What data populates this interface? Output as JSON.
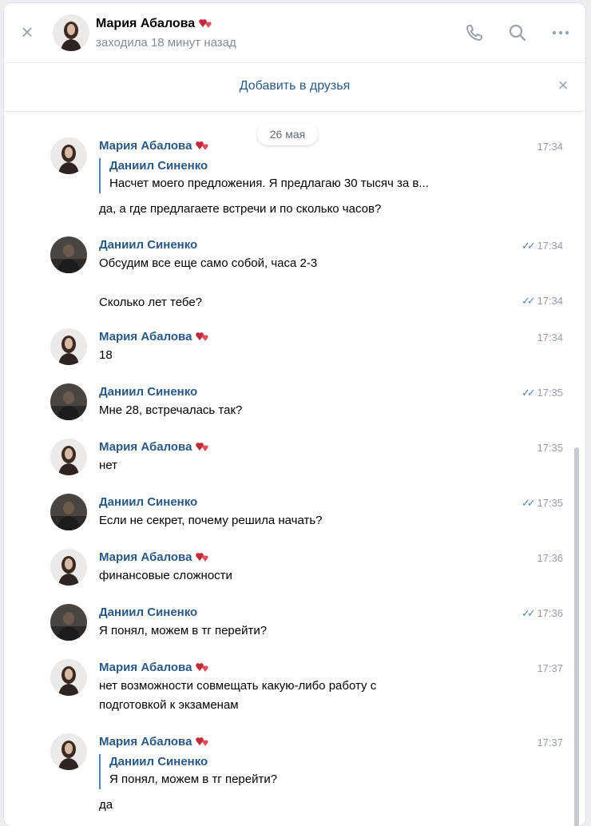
{
  "header": {
    "name": "Мария Абалова",
    "status": "заходила 18 минут назад",
    "icons": [
      "close-icon",
      "phone-icon",
      "search-icon",
      "more-icon"
    ]
  },
  "friend_bar": {
    "label": "Добавить в друзья"
  },
  "colors": {
    "link": "#2a5885",
    "accent": "#5181b8",
    "muted": "#818c99",
    "heart": "#c02a3a"
  },
  "chat": {
    "date": "26 мая",
    "messages": [
      {
        "author": "Мария Абалова",
        "time": "17:34",
        "quote_author": "Даниил Синенко",
        "quote_text": "Насчет моего предложения. Я предлагаю 30 тысяч за в...",
        "text": "да, а где предлагаете встречи и по сколько часов?"
      },
      {
        "author": "Даниил Синенко",
        "time": "17:34",
        "text": "Обсудим все еще само собой, часа 2-3"
      },
      {
        "time": "17:34",
        "text": "Сколько лет тебе?"
      },
      {
        "author": "Мария Абалова",
        "time": "17:34",
        "text": "18"
      },
      {
        "author": "Даниил Синенко",
        "time": "17:35",
        "text": "Мне 28, встречалась так?"
      },
      {
        "author": "Мария Абалова",
        "time": "17:35",
        "text": "нет"
      },
      {
        "author": "Даниил Синенко",
        "time": "17:35",
        "text": "Если не секрет, почему решила начать?"
      },
      {
        "author": "Мария Абалова",
        "time": "17:36",
        "text": "финансовые сложности"
      },
      {
        "author": "Даниил Синенко",
        "time": "17:36",
        "text": "Я понял, можем в тг перейти?"
      },
      {
        "author": "Мария Абалова",
        "time": "17:37",
        "text": "нет возможности совмещать какую-либо работу с",
        "text2": "подготовкой к экзаменам"
      },
      {
        "author": "Мария Абалова",
        "time": "17:37",
        "quote_author": "Даниил Синенко",
        "quote_text": "Я понял, можем в тг перейти?",
        "text": "да"
      }
    ]
  }
}
